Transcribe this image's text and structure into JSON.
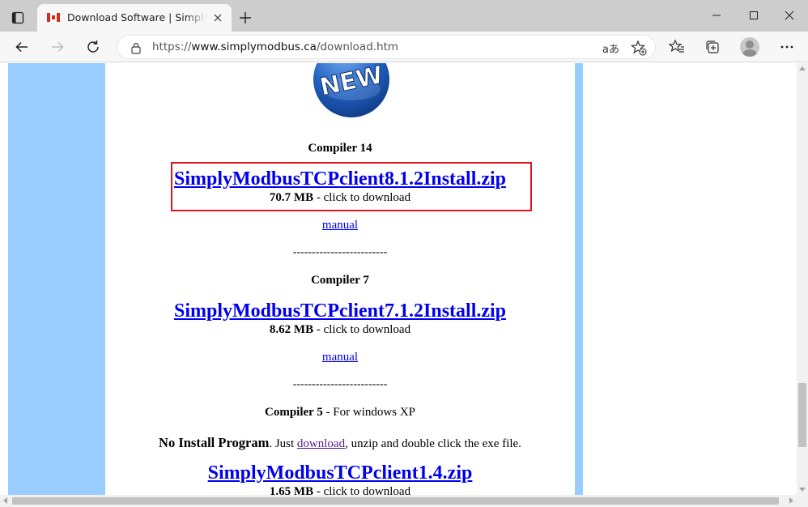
{
  "tab": {
    "title": "Download Software | Simply Modbus"
  },
  "address": {
    "scheme": "https://",
    "host": "www.simplymodbus.ca",
    "path": "/download.htm",
    "read_aloud": "aあ"
  },
  "page": {
    "badge": "NEW",
    "sections": [
      {
        "heading": "Compiler 14",
        "file": "SimplyModbusTCPclient8.1.2Install.zip",
        "size": "70.7 MB",
        "size_suffix": " - click to download",
        "manual": "manual"
      },
      {
        "heading": "Compiler 7",
        "file": "SimplyModbusTCPclient7.1.2Install.zip",
        "size": "8.62 MB",
        "size_suffix": " - click to download",
        "manual": "manual"
      },
      {
        "heading": "Compiler 5",
        "heading_suffix": " - For windows XP",
        "noinstall_bold": "No Install Program",
        "noinstall_text1": ". Just ",
        "noinstall_link": "download",
        "noinstall_text2": ", unzip and double click the exe file.",
        "file": "SimplyModbusTCPclient1.4.zip",
        "size": "1.65 MB",
        "size_suffix": " - click to download"
      }
    ],
    "separator": "-------------------------"
  },
  "colors": {
    "band": "#99ccff",
    "link": "#0000ee",
    "visited": "#551a8b",
    "highlight": "#d71920"
  }
}
